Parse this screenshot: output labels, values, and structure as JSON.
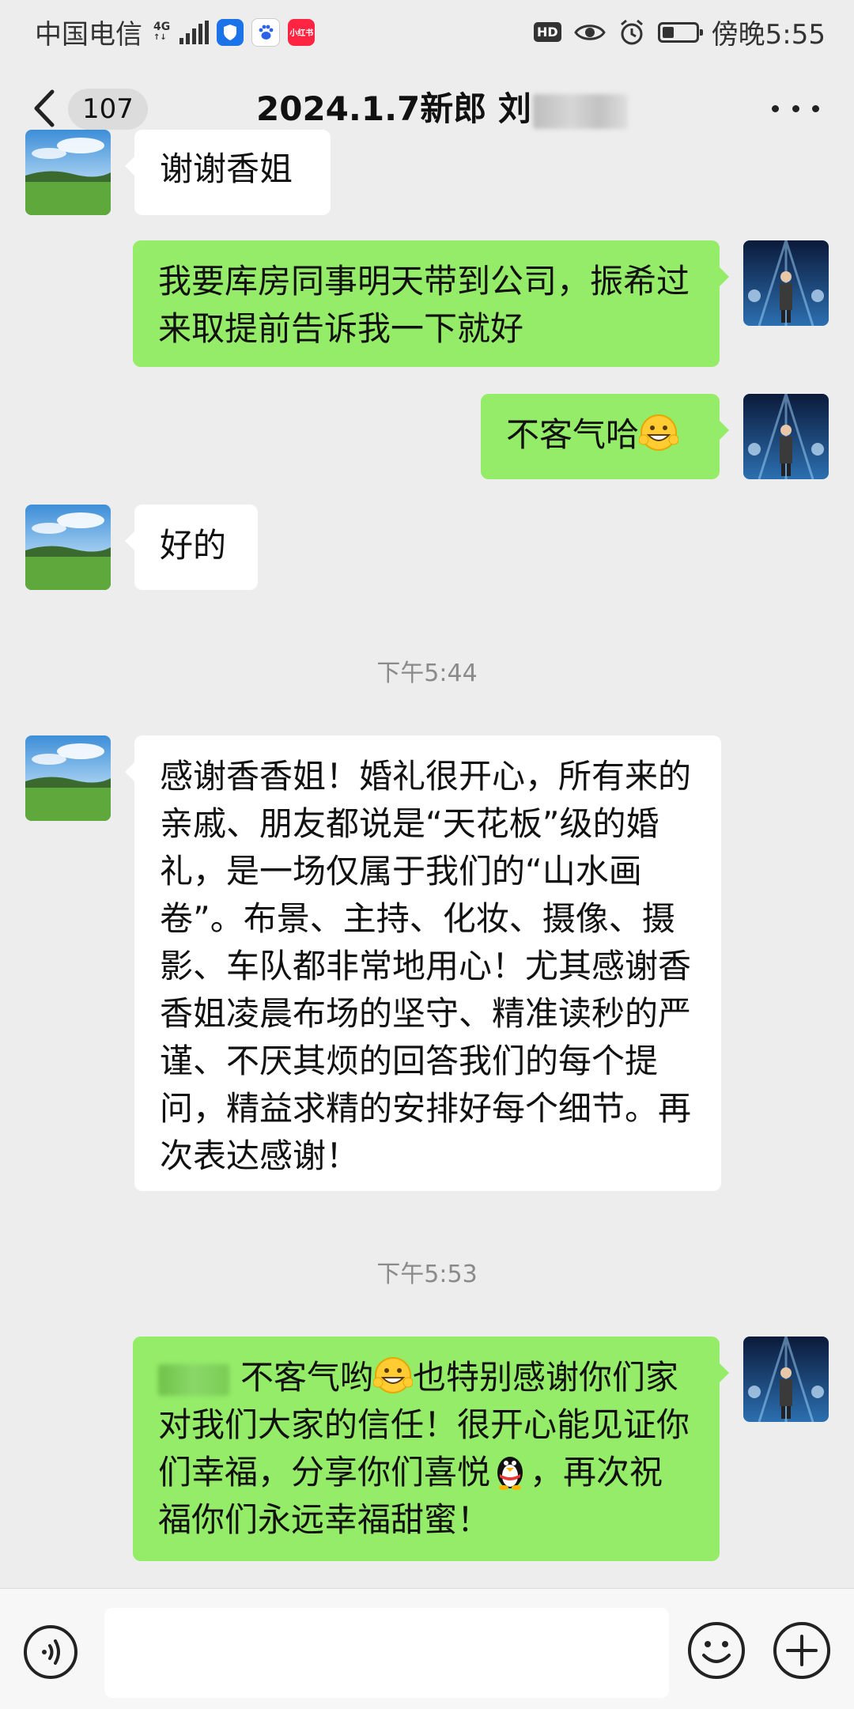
{
  "status_bar": {
    "carrier": "中国电信",
    "network": "4G",
    "app_badge_text": "小红书",
    "hd_label": "HD",
    "time": "傍晚5:55"
  },
  "header": {
    "unread_count": "107",
    "title": "2024.1.7新郎 刘"
  },
  "messages": [
    {
      "side": "in",
      "text": "谢谢香姐"
    },
    {
      "side": "out",
      "text": "我要库房同事明天带到公司，振希过来取提前告诉我一下就好"
    },
    {
      "side": "out",
      "text": "不客气哈"
    },
    {
      "side": "in",
      "text": "好的"
    },
    {
      "type": "time",
      "text": "下午5:44"
    },
    {
      "side": "in",
      "text": "感谢香香姐！婚礼很开心，所有来的亲戚、朋友都说是“天花板”级的婚礼，是一场仅属于我们的“山水画卷”。布景、主持、化妆、摄像、摄影、车队都非常地用心！尤其感谢香香姐凌晨布场的坚守、精准读秒的严谨、不厌其烦的回答我们的每个提问，精益求精的安排好每个细节。再次表达感谢！"
    },
    {
      "type": "time",
      "text": "下午5:53"
    },
    {
      "side": "out",
      "parts": [
        "不客气哟",
        "也特别感谢你们家对我们大家的信任！很开心能见证你们幸福，分享你们喜悦",
        "，再次祝福你们永远幸福甜蜜！"
      ]
    }
  ],
  "colors": {
    "background": "#ededed",
    "bubble_out": "#95ec69",
    "bubble_in": "#ffffff"
  },
  "icons": {
    "back": "chevron-left-icon",
    "more": "more-dots-icon",
    "voice": "voice-icon",
    "emoji": "smile-icon",
    "plus": "plus-icon"
  }
}
